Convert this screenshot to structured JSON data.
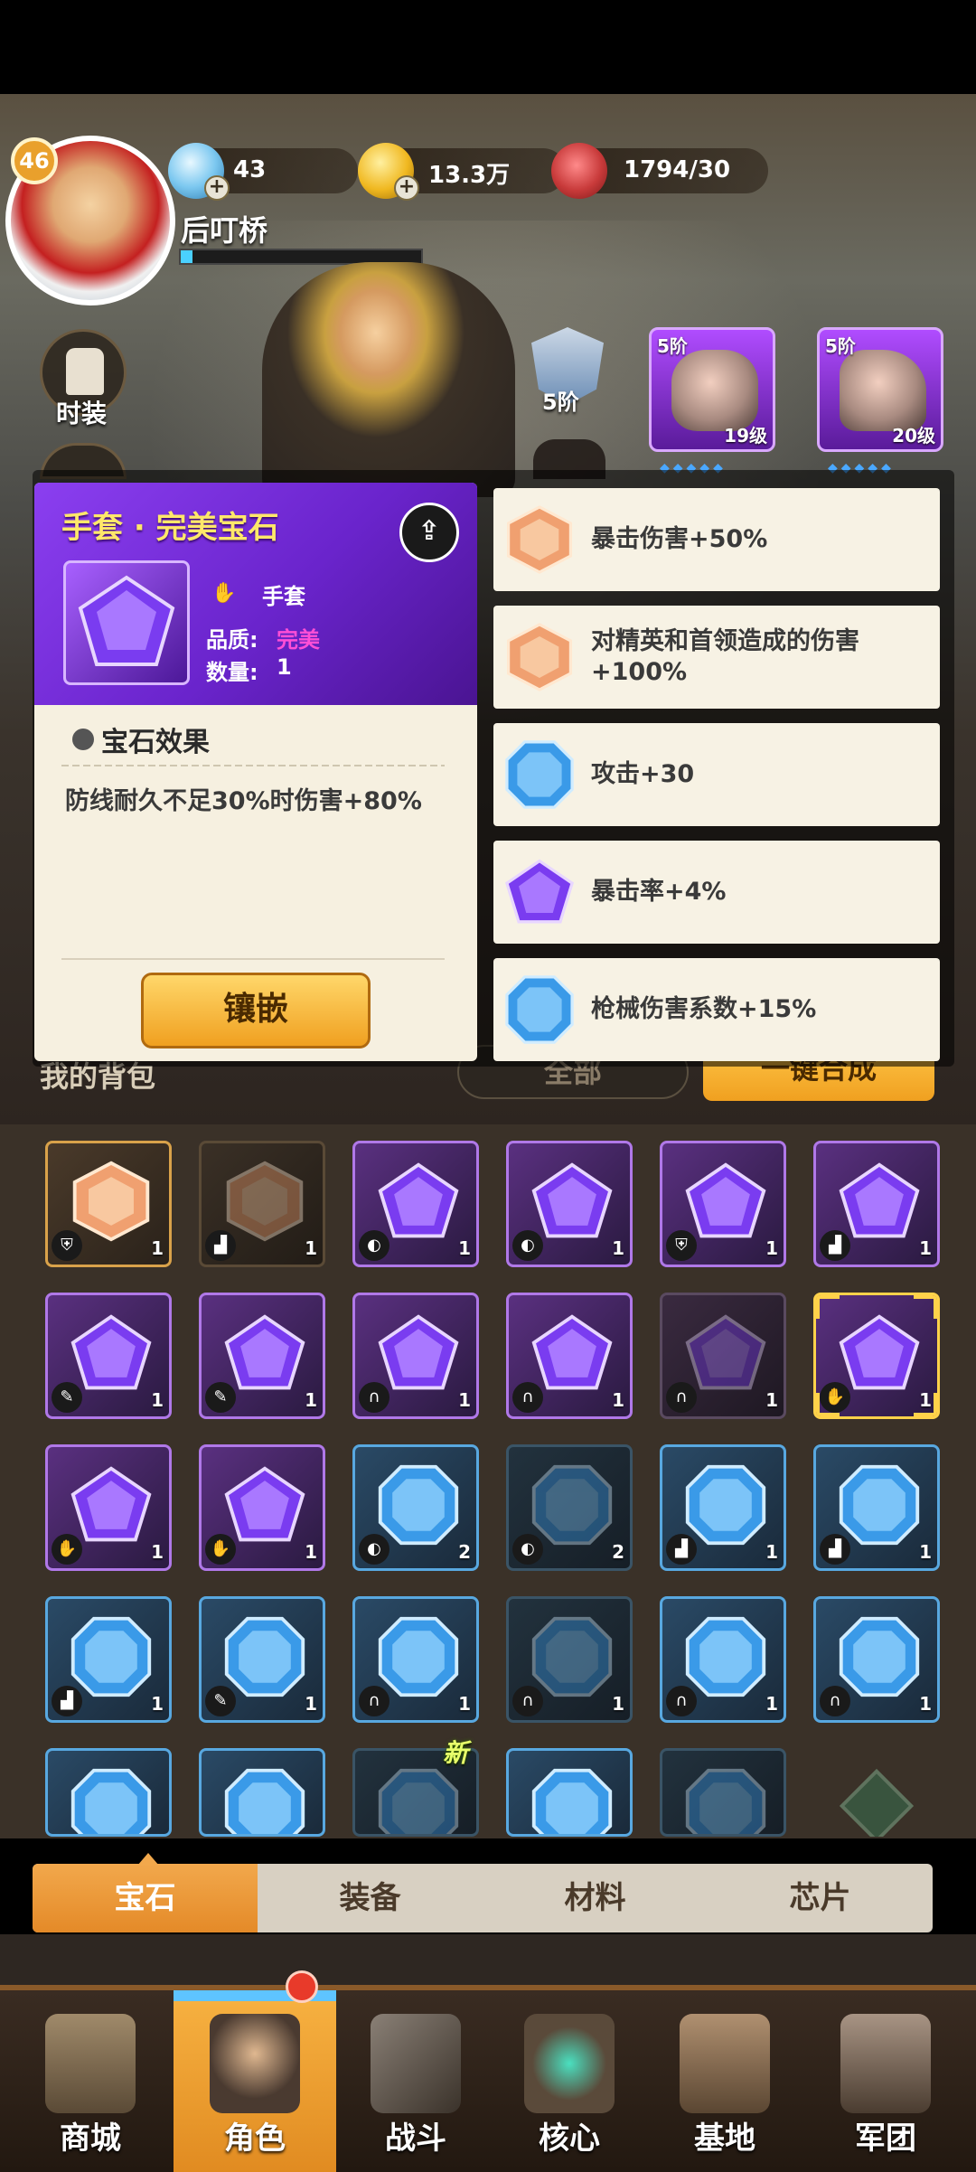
{
  "header": {
    "player_level": "46",
    "player_name": "后叮桥",
    "xp_fraction": 0.05,
    "diamonds": "43",
    "coins": "13.3万",
    "stamina": "1794/30",
    "fashion_label": "时装"
  },
  "hero_panel": {
    "rank_label": "5阶",
    "equip": [
      {
        "tier": "5阶",
        "level": "19级",
        "icon": "helmet-icon"
      },
      {
        "tier": "5阶",
        "level": "20级",
        "icon": "boots-icon"
      }
    ]
  },
  "gem_card": {
    "title": "手套 · 完美宝石",
    "slot_name": "手套",
    "quality_label": "品质:",
    "quality_value": "完美",
    "quantity_label": "数量:",
    "quantity_value": "1",
    "effect_heading": "宝石效果",
    "effect_text": "防线耐久不足30%时伤害+80%",
    "embed_button": "镶嵌",
    "share_icon": "share-icon",
    "colors": {
      "perfect": "#ff4fd6",
      "title": "#ffe86a"
    }
  },
  "gem_effects": [
    {
      "gem": "orange",
      "text": "暴击伤害+50%"
    },
    {
      "gem": "orange",
      "text": "对精英和首领造成的伤害+100%"
    },
    {
      "gem": "blue",
      "text": "攻击+30"
    },
    {
      "gem": "purple",
      "text": "暴击率+4%"
    },
    {
      "gem": "blue",
      "text": "枪械伤害系数+15%"
    }
  ],
  "filter": {
    "my_bag": "我的背包",
    "all": "全部",
    "synth": "一键合成"
  },
  "inventory": {
    "new_badge": "新",
    "rows": [
      [
        {
          "gem": "orange",
          "dim": false,
          "part": "armor",
          "count": "1"
        },
        {
          "gem": "orange",
          "dim": true,
          "part": "boots",
          "count": "1"
        },
        {
          "gem": "purple",
          "dim": false,
          "part": "helmet",
          "count": "1"
        },
        {
          "gem": "purple",
          "dim": false,
          "part": "helmet",
          "count": "1"
        },
        {
          "gem": "purple",
          "dim": false,
          "part": "armor",
          "count": "1"
        },
        {
          "gem": "purple",
          "dim": false,
          "part": "boots",
          "count": "1"
        }
      ],
      [
        {
          "gem": "purple",
          "dim": false,
          "part": "gun",
          "count": "1"
        },
        {
          "gem": "purple",
          "dim": false,
          "part": "gun",
          "count": "1"
        },
        {
          "gem": "purple",
          "dim": false,
          "part": "pants",
          "count": "1"
        },
        {
          "gem": "purple",
          "dim": false,
          "part": "pants",
          "count": "1"
        },
        {
          "gem": "purple",
          "dim": true,
          "part": "pants",
          "count": "1"
        },
        {
          "gem": "purple",
          "dim": false,
          "part": "glove",
          "count": "1",
          "selected": true
        }
      ],
      [
        {
          "gem": "purple",
          "dim": false,
          "part": "glove",
          "count": "1"
        },
        {
          "gem": "purple",
          "dim": false,
          "part": "glove",
          "count": "1"
        },
        {
          "gem": "blue",
          "dim": false,
          "part": "helmet",
          "count": "2"
        },
        {
          "gem": "blue",
          "dim": true,
          "part": "helmet",
          "count": "2"
        },
        {
          "gem": "blue",
          "dim": false,
          "part": "boots",
          "count": "1"
        },
        {
          "gem": "blue",
          "dim": false,
          "part": "boots",
          "count": "1"
        }
      ],
      [
        {
          "gem": "blue",
          "dim": false,
          "part": "boots",
          "count": "1"
        },
        {
          "gem": "blue",
          "dim": false,
          "part": "gun",
          "count": "1"
        },
        {
          "gem": "blue",
          "dim": false,
          "part": "pants",
          "count": "1"
        },
        {
          "gem": "blue",
          "dim": true,
          "part": "pants",
          "count": "1"
        },
        {
          "gem": "blue",
          "dim": false,
          "part": "pants",
          "count": "1"
        },
        {
          "gem": "blue",
          "dim": false,
          "part": "pants",
          "count": "1"
        }
      ],
      [
        {
          "gem": "blue",
          "dim": false,
          "part": "",
          "count": ""
        },
        {
          "gem": "blue",
          "dim": false,
          "part": "",
          "count": ""
        },
        {
          "gem": "blue",
          "dim": true,
          "part": "",
          "count": "",
          "is_new": true
        },
        {
          "gem": "blue",
          "dim": false,
          "part": "",
          "count": ""
        },
        {
          "gem": "blue",
          "dim": true,
          "part": "",
          "count": ""
        },
        {
          "gem": "green",
          "dim": true,
          "part": "",
          "count": ""
        }
      ]
    ]
  },
  "tabs": [
    "宝石",
    "装备",
    "材料",
    "芯片"
  ],
  "active_tab": "宝石",
  "bottom_nav": [
    {
      "label": "商城",
      "icon": "shop-icon"
    },
    {
      "label": "角色",
      "icon": "character-icon",
      "active": true
    },
    {
      "label": "战斗",
      "icon": "battle-icon"
    },
    {
      "label": "核心",
      "icon": "core-icon"
    },
    {
      "label": "基地",
      "icon": "base-icon"
    },
    {
      "label": "军团",
      "icon": "legion-icon"
    }
  ]
}
